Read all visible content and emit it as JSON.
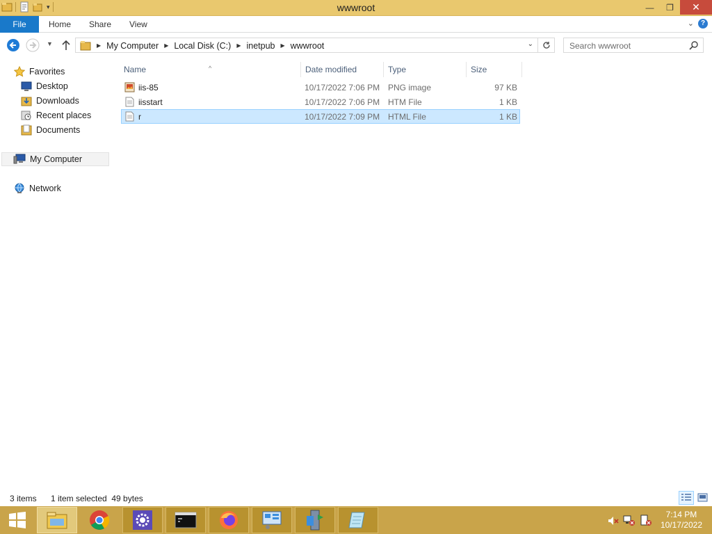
{
  "window": {
    "title": "wwwroot"
  },
  "ribbon": {
    "tabs": [
      "File",
      "Home",
      "Share",
      "View"
    ]
  },
  "address": {
    "breadcrumbs": [
      "My Computer",
      "Local Disk (C:)",
      "inetpub",
      "wwwroot"
    ],
    "search_placeholder": "Search wwwroot"
  },
  "nav": {
    "favorites_label": "Favorites",
    "favorites": [
      "Desktop",
      "Downloads",
      "Recent places",
      "Documents"
    ],
    "computer_label": "My Computer",
    "network_label": "Network"
  },
  "columns": {
    "name": "Name",
    "date": "Date modified",
    "type": "Type",
    "size": "Size"
  },
  "files": [
    {
      "name": "iis-85",
      "date": "10/17/2022 7:06 PM",
      "type": "PNG image",
      "size": "97 KB",
      "icon": "png-file-icon"
    },
    {
      "name": "iisstart",
      "date": "10/17/2022 7:06 PM",
      "type": "HTM File",
      "size": "1 KB",
      "icon": "htm-file-icon"
    },
    {
      "name": "r",
      "date": "10/17/2022 7:09 PM",
      "type": "HTML File",
      "size": "1 KB",
      "icon": "html-file-icon",
      "selected": true
    }
  ],
  "status": {
    "count": "3 items",
    "selection": "1 item selected  49 bytes"
  },
  "taskbar": {
    "apps": [
      "file-explorer",
      "chrome",
      "settings",
      "command-prompt",
      "firefox",
      "network-tool",
      "server-tool",
      "notepad"
    ],
    "time": "7:14 PM",
    "date": "10/17/2022"
  },
  "colors": {
    "titlebar": "#e9c86e",
    "file_tab": "#1979ca",
    "selection": "#cce8ff",
    "taskbar": "#c9a44a",
    "close": "#c74b3c"
  }
}
